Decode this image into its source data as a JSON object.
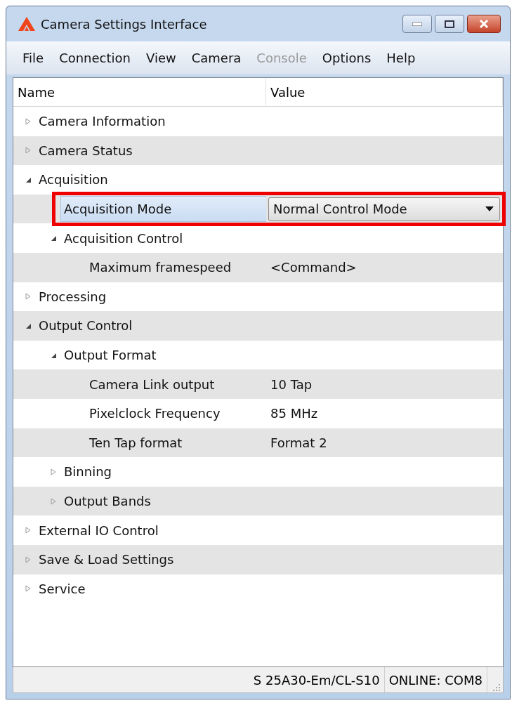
{
  "window": {
    "title": "Camera Settings Interface"
  },
  "menu": [
    {
      "label": "File",
      "disabled": false
    },
    {
      "label": "Connection",
      "disabled": false
    },
    {
      "label": "View",
      "disabled": false
    },
    {
      "label": "Camera",
      "disabled": false
    },
    {
      "label": "Console",
      "disabled": true
    },
    {
      "label": "Options",
      "disabled": false
    },
    {
      "label": "Help",
      "disabled": false
    }
  ],
  "table": {
    "columns": [
      "Name",
      "Value"
    ],
    "rows": [
      {
        "kind": "group",
        "name": "Camera Information",
        "expanded": false,
        "selected": false
      },
      {
        "kind": "group",
        "name": "Camera Status",
        "expanded": false,
        "selected": false
      },
      {
        "kind": "group",
        "name": "Acquisition",
        "expanded": true,
        "selected": false,
        "children": [
          {
            "kind": "dropdown",
            "name": "Acquisition Mode",
            "value": "Normal Control Mode",
            "selected": true,
            "highlighted": true
          },
          {
            "kind": "group",
            "name": "Acquisition Control",
            "expanded": true,
            "selected": false,
            "children": [
              {
                "kind": "property",
                "name": "Maximum framespeed",
                "value": "<Command>",
                "selected": false
              }
            ]
          }
        ]
      },
      {
        "kind": "group",
        "name": "Processing",
        "expanded": false,
        "selected": false
      },
      {
        "kind": "group",
        "name": "Output Control",
        "expanded": true,
        "selected": false,
        "children": [
          {
            "kind": "group",
            "name": "Output Format",
            "expanded": true,
            "selected": false,
            "children": [
              {
                "kind": "property",
                "name": "Camera Link output",
                "value": "10 Tap",
                "selected": false
              },
              {
                "kind": "property",
                "name": "Pixelclock Frequency",
                "value": "85 MHz",
                "selected": false
              },
              {
                "kind": "property",
                "name": "Ten Tap format",
                "value": "Format 2",
                "selected": false
              }
            ]
          },
          {
            "kind": "group",
            "name": "Binning",
            "expanded": false,
            "selected": false
          },
          {
            "kind": "group",
            "name": "Output Bands",
            "expanded": false,
            "selected": false
          }
        ]
      },
      {
        "kind": "group",
        "name": "External IO Control",
        "expanded": false,
        "selected": false
      },
      {
        "kind": "group",
        "name": "Save & Load Settings",
        "expanded": false,
        "selected": false
      },
      {
        "kind": "group",
        "name": "Service",
        "expanded": false,
        "selected": false
      }
    ]
  },
  "status_bar": {
    "model": "S 25A30-Em/CL-S10",
    "connection": "ONLINE: COM8"
  }
}
